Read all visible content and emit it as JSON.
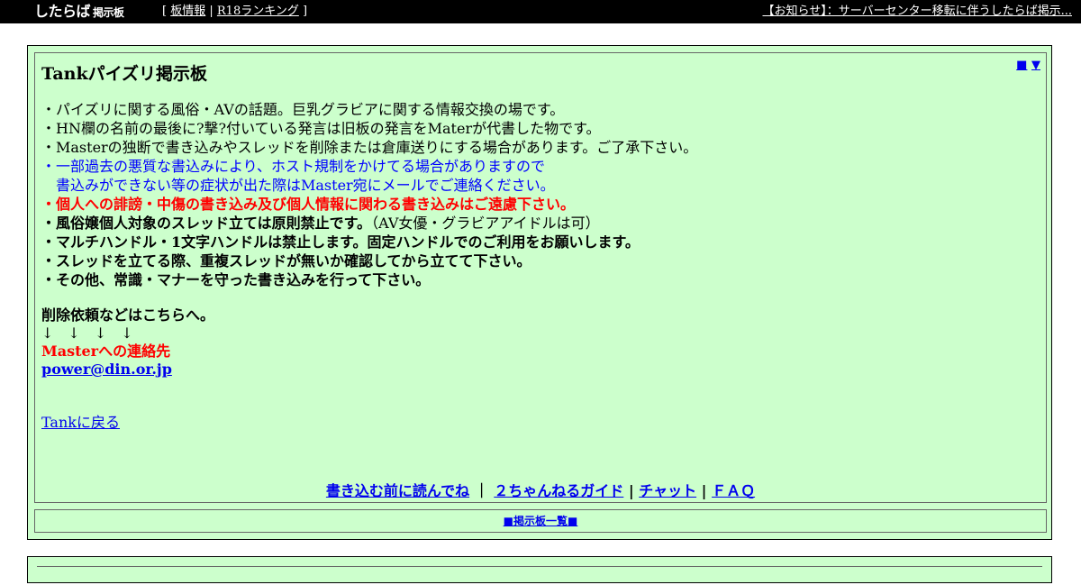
{
  "topbar": {
    "logo_main": "したらば",
    "logo_small": "掲示板",
    "bracket_open": "[ ",
    "nav_board_info": "板情報",
    "separator": " | ",
    "nav_ranking": "R18ランキング",
    "bracket_close": " ]",
    "notice": "【お知らせ】：サーバーセンター移転に伴うしたらば掲示..."
  },
  "board": {
    "title": "Tankパイズリ掲示板",
    "corner_square": "■",
    "corner_down": "▼",
    "rules": [
      "・パイズリに関する風俗・AVの話題。巨乳グラビアに関する情報交換の場です。",
      "・HN欄の名前の最後に?撃?付いている発言は旧板の発言をMaterが代書した物です。",
      "・Masterの独断で書き込みやスレッドを削除または倉庫送りにする場合があります。ご了承下さい。"
    ],
    "blue_rule_1": "・一部過去の悪質な書込みにより、ホスト規制をかけてる場合がありますので",
    "blue_rule_2": "書込みができない等の症状が出た際はMaster宛にメールでご連絡ください。",
    "red_rule": "・個人への誹謗・中傷の書き込み及び個人情報に関わる書き込みはご遠慮下さい。",
    "bold_rule_main": "・風俗嬢個人対象のスレッド立ては原則禁止です。",
    "bold_rule_note": "（AV女優・グラビアアイドルは可）",
    "bold_rules": [
      "・マルチハンドル・1文字ハンドルは禁止します。固定ハンドルでのご利用をお願いします。",
      "・スレッドを立てる際、重複スレッドが無いか確認してから立てて下さい。",
      "・その他、常識・マナーを守った書き込みを行って下さい。"
    ],
    "contact_heading": "削除依頼などはこちらへ。",
    "arrows": "↓　↓　↓　↓",
    "contact_label": "Masterへの連絡先",
    "contact_email": "power@din.or.jp",
    "back_link": "Tankに戻る",
    "bottom_links": {
      "read_first": "書き込む前に読んでね",
      "sep1": " ｜ ",
      "guide": "２ちゃんねるガイド",
      "sep2": " | ",
      "chat": "チャット",
      "sep3": " | ",
      "faq": "ＦＡＱ"
    },
    "board_list": "■掲示板一覧■"
  },
  "colors": {
    "panel_bg": "#ccffcc",
    "link": "#0000ee",
    "warning_red": "#ff0000",
    "notice_blue": "#0000ff",
    "topbar_bg": "#000000"
  }
}
